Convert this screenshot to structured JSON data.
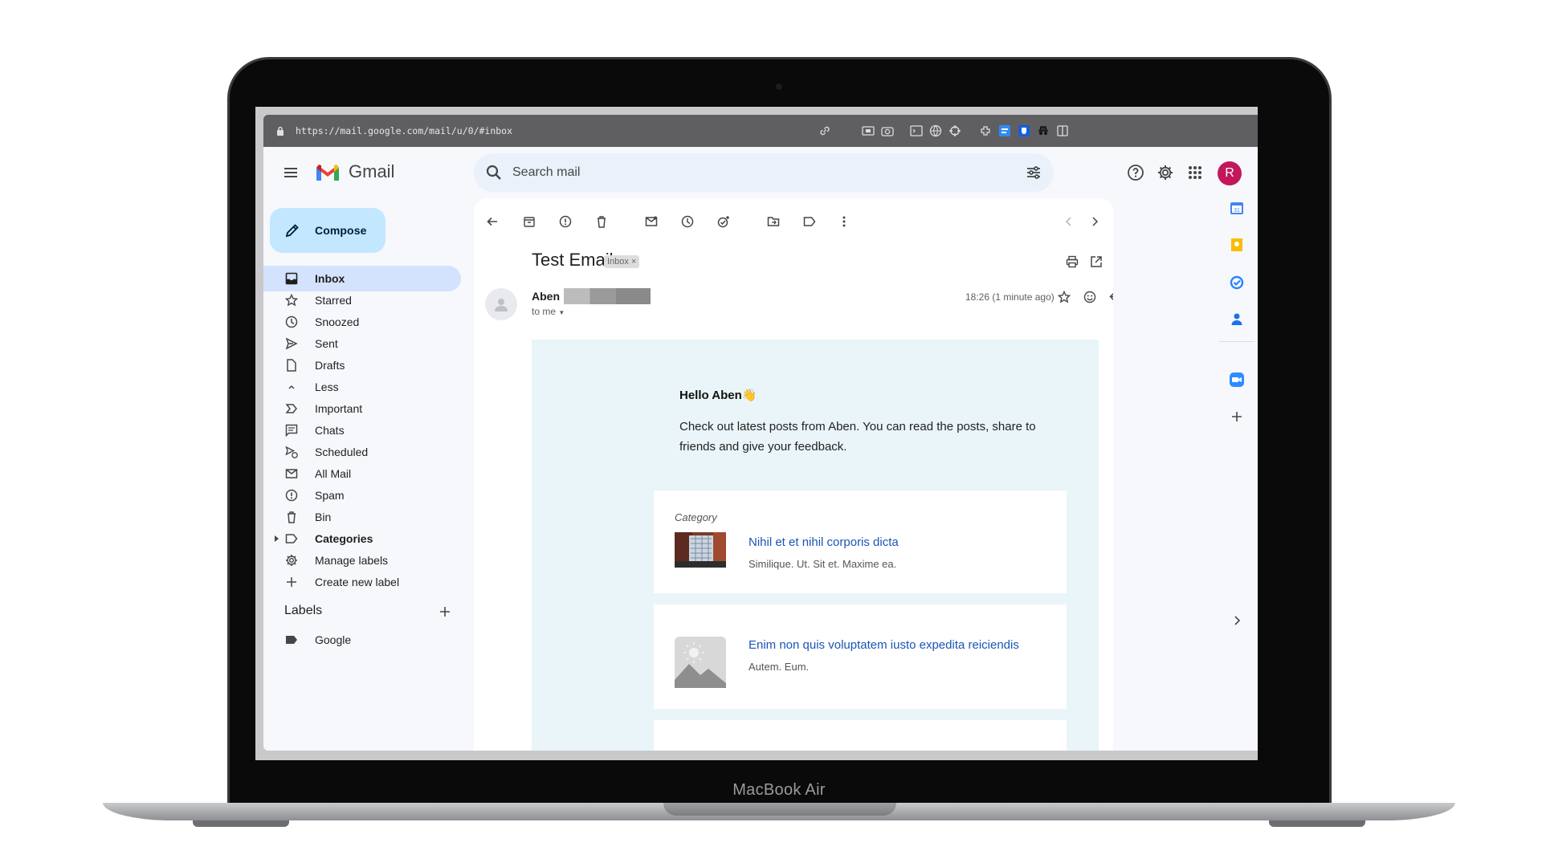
{
  "device": {
    "brand_label": "MacBook Air"
  },
  "browser": {
    "url": "https://mail.google.com/mail/u/0/#inbox"
  },
  "header": {
    "app_title": "Gmail",
    "search_placeholder": "Search mail",
    "avatar_letter": "R",
    "avatar_color": "#c2185b"
  },
  "sidebar": {
    "compose_label": "Compose",
    "items": [
      {
        "label": "Inbox",
        "icon": "inbox-icon",
        "active": true
      },
      {
        "label": "Starred",
        "icon": "star-icon"
      },
      {
        "label": "Snoozed",
        "icon": "clock-icon"
      },
      {
        "label": "Sent",
        "icon": "send-icon"
      },
      {
        "label": "Drafts",
        "icon": "draft-icon"
      },
      {
        "label": "Less",
        "icon": "chevron-up-icon"
      },
      {
        "label": "Important",
        "icon": "important-icon"
      },
      {
        "label": "Chats",
        "icon": "chat-icon"
      },
      {
        "label": "Scheduled",
        "icon": "scheduled-send-icon"
      },
      {
        "label": "All Mail",
        "icon": "all-mail-icon"
      },
      {
        "label": "Spam",
        "icon": "spam-icon"
      },
      {
        "label": "Bin",
        "icon": "trash-icon"
      },
      {
        "label": "Categories",
        "icon": "label-icon"
      },
      {
        "label": "Manage labels",
        "icon": "gear-icon"
      },
      {
        "label": "Create new label",
        "icon": "plus-icon"
      }
    ],
    "labels_heading": "Labels",
    "labels": [
      {
        "label": "Google",
        "icon": "label-filled-icon"
      }
    ]
  },
  "message": {
    "subject": "Test Email",
    "chip": "Inbox ×",
    "sender_name": "Aben",
    "recipient": "to me",
    "timestamp": "18:26 (1 minute ago)"
  },
  "email_body": {
    "greeting": "Hello Aben",
    "greeting_emoji": "👋",
    "intro": "Check out latest posts from Aben. You can read the posts, share to friends and give your feedback.",
    "category_label": "Category",
    "posts": [
      {
        "title": "Nihil et et nihil corporis dicta",
        "subtitle": "Similique. Ut. Sit et. Maxime ea."
      },
      {
        "title": "Enim non quis voluptatem iusto expedita reiciendis",
        "subtitle": "Autem. Eum."
      }
    ],
    "link_color": "#1a55b8",
    "body_background": "#e9f5f8"
  },
  "colors": {
    "compose_bg": "#c2e7ff",
    "active_nav_bg": "#d3e3fd",
    "search_bg": "#eaf1fb",
    "gmail_red": "#ea4335"
  }
}
